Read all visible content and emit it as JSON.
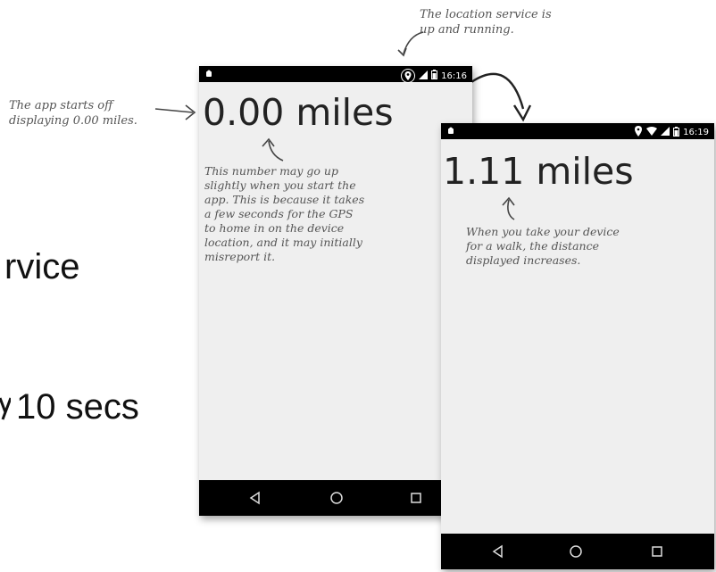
{
  "slide": {
    "text_service": "rvice",
    "text_secs": "10 secs"
  },
  "annotations": {
    "location_service": "The location service is\nup and running.",
    "app_starts": "The app starts off\ndisplaying 0.00 miles.",
    "number_may_go_up": "This number may go up\nslightly when you start the\napp. This is because it takes\na few seconds for the GPS\nto home in on the device\nlocation, and it may initially\nmisreport it.",
    "walk": "When you take your device\nfor a walk, the distance\ndisplayed increases."
  },
  "phone1": {
    "time": "16:16",
    "distance": "0.00 miles"
  },
  "phone2": {
    "time": "16:19",
    "distance": "1.11 miles"
  },
  "icons": {
    "status_left": "android-icon",
    "location": "location-pin-icon",
    "wifi": "wifi-icon",
    "signal": "signal-icon",
    "battery": "battery-icon",
    "nav_back": "back-triangle-icon",
    "nav_home": "home-circle-icon",
    "nav_recent": "recent-square-icon"
  }
}
